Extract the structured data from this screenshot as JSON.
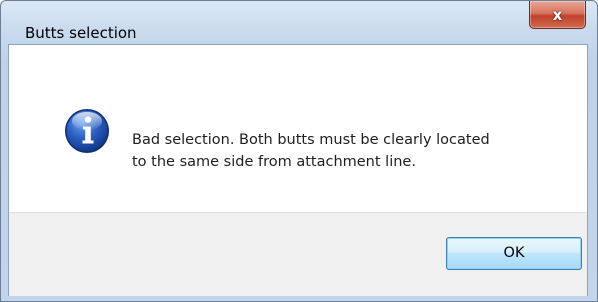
{
  "window": {
    "title": "Butts selection",
    "close_label": "x"
  },
  "dialog": {
    "icon": "information-icon",
    "message": "Bad selection. Both butts must be clearly located\nto the same side from attachment line.",
    "ok_label": "OK"
  },
  "colors": {
    "close_button": "#c9452e",
    "ok_button_border": "#3c7fb1",
    "info_icon": "#1f4fa6"
  }
}
